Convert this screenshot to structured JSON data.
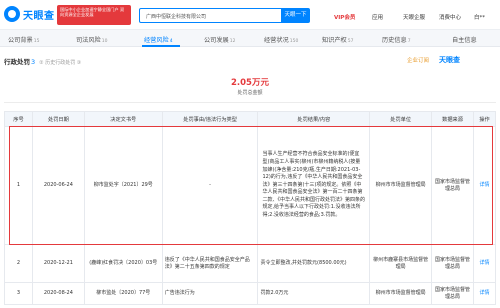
{
  "header": {
    "logo_text": "天眼查",
    "promo_text": "国际中小企业加速宁静全国门户 双向资源全企业发展",
    "search_value": "广西中恒联企科技有限公司",
    "search_button": "天眼一下",
    "nav": [
      "VIP会员",
      "应用",
      "天眼企服",
      "消费中心",
      "白**"
    ]
  },
  "tabs": [
    {
      "label": "公司背景",
      "count": "15"
    },
    {
      "label": "司法风险",
      "count": "10"
    },
    {
      "label": "经营风险",
      "count": "4"
    },
    {
      "label": "公司发展",
      "count": "12"
    },
    {
      "label": "经营状况",
      "count": "150"
    },
    {
      "label": "知识产权",
      "count": "57"
    },
    {
      "label": "历史信息",
      "count": "7"
    },
    {
      "label": "自主信息",
      "count": ""
    }
  ],
  "section": {
    "title": "行政处罚",
    "count": "3",
    "hint": "② 历史行政处罚 ③",
    "sub_label": "企业订阅",
    "brand": "天眼查"
  },
  "summary": {
    "amount": "2.05万元",
    "label": "处罚总金额"
  },
  "table": {
    "headers": [
      "序号",
      "处罚日期",
      "决定文书号",
      "处罚事由/违法行为类型",
      "处罚结果/内容",
      "处罚单位",
      "数据来源",
      "操作"
    ],
    "rows": [
      {
        "index": "1",
        "date": "2020-06-24",
        "doc_no": "柳市监处字〔2021〕29号",
        "reason": "-",
        "result": "当事人生产经营不符合食品安全标准的(便宜型)商品工人事实(柳州)市柳州籍纳税人(按量加蜂)(净含量:210克/瓶,生产日期:2021-03-12)的行为,违反了《中华人民共和国食品安全法》第三十四条第(十三)项的规定。依照《中华人民共和国食品安全法》第一百二十四条第二款、《中华人民共和国行政处罚法》第四条的规定,给予当事人以下行政处罚:1.没收违法所得;2.没收违法经营的食品;3.罚款。",
        "unit": "柳州市市场监督管理局",
        "source": "国家市场监督管理总局",
        "action": "详情"
      },
      {
        "index": "2",
        "date": "2020-12-21",
        "doc_no": "(鹿峰)红食罚决〔2020〕03号",
        "reason": "违反了《中华人民共和国食品安全产品法》第二十五条第四款的规定",
        "result": "责令立即整改,并处罚款元(8500.00元)",
        "unit": "柳州市鹿寨县市场监督管理局",
        "source": "国家市场监督管理总局",
        "action": "详情"
      },
      {
        "index": "3",
        "date": "2020-08-24",
        "doc_no": "柳市监处〔2020〕77号",
        "reason": "广告违法行为",
        "result": "罚款2.0万元",
        "unit": "柳州市市场监督管理局",
        "source": "国家市场监督管理总局",
        "action": "详情"
      }
    ]
  }
}
